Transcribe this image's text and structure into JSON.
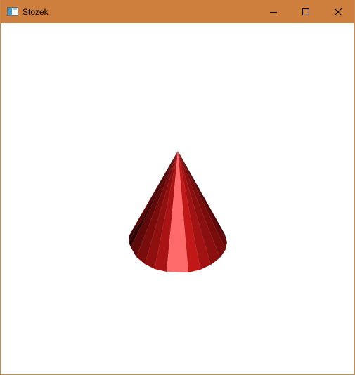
{
  "window": {
    "title": "Stozek",
    "accent_color": "#cf7f3d",
    "icons": {
      "app": "window-app-icon",
      "minimize": "minimize-icon",
      "maximize": "maximize-icon",
      "close": "close-icon"
    }
  },
  "scene": {
    "object": "cone",
    "colors": {
      "dark": "#4a0a0a",
      "mid": "#8e1010",
      "bright": "#c01818",
      "highlight": "#ff6666"
    }
  }
}
